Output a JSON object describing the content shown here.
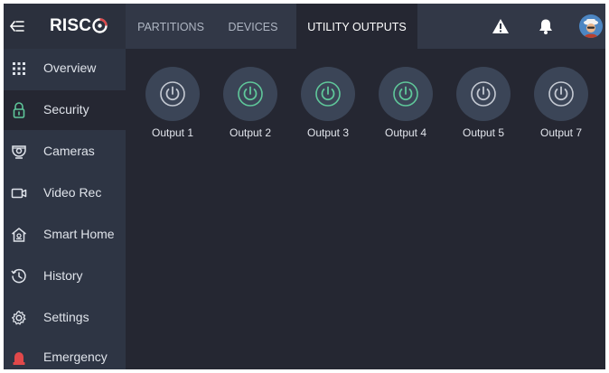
{
  "brand": {
    "logo_text": "RISC",
    "back_icon": "collapse-menu-icon"
  },
  "sidebar": {
    "items": [
      {
        "label": "Overview",
        "icon": "grid-icon",
        "active": false
      },
      {
        "label": "Security",
        "icon": "lock-icon",
        "active": true
      },
      {
        "label": "Cameras",
        "icon": "camera-icon",
        "active": false
      },
      {
        "label": "Video Rec",
        "icon": "video-icon",
        "active": false
      },
      {
        "label": "Smart Home",
        "icon": "home-icon",
        "active": false
      },
      {
        "label": "History",
        "icon": "history-icon",
        "active": false
      },
      {
        "label": "Settings",
        "icon": "gear-icon",
        "active": false
      },
      {
        "label": "Emergency",
        "icon": "siren-icon",
        "active": false
      }
    ]
  },
  "tabs": [
    {
      "label": "PARTITIONS",
      "active": false
    },
    {
      "label": "DEVICES",
      "active": false
    },
    {
      "label": "UTILITY OUTPUTS",
      "active": true
    }
  ],
  "header_icons": [
    "warning-icon",
    "bell-icon",
    "avatar"
  ],
  "outputs": [
    {
      "label": "Output 1",
      "state": "off"
    },
    {
      "label": "Output 2",
      "state": "on"
    },
    {
      "label": "Output 3",
      "state": "on"
    },
    {
      "label": "Output 4",
      "state": "on"
    },
    {
      "label": "Output 5",
      "state": "off"
    },
    {
      "label": "Output 7",
      "state": "off"
    }
  ],
  "colors": {
    "background": "#252732",
    "sidebar": "#2e3544",
    "topbar": "#323847",
    "on": "#5fc79a",
    "off": "#c4c9d2",
    "emergency": "#e0484a",
    "accent_security": "#5fc79a"
  }
}
